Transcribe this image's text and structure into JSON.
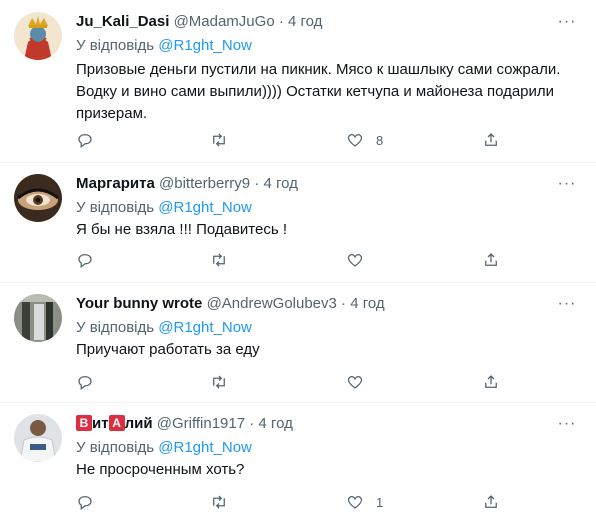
{
  "tweets": [
    {
      "name": "Ju_Kali_Dasi",
      "handle": "@MadamJuGo",
      "dot": "·",
      "time": "4 год",
      "reply_prefix": "У відповідь",
      "reply_to": "@R1ght_Now",
      "text": "Призовые деньги пустили на пикник. Мясо к шашлыку сами сожрали. Водку и вино сами выпили)))) Остатки кетчупа и майонеза подарили призерам.",
      "reply_count": "",
      "retweet_count": "",
      "like_count": "8"
    },
    {
      "name": "Маргарита",
      "handle": "@bitterberry9",
      "dot": "·",
      "time": "4 год",
      "reply_prefix": "У відповідь",
      "reply_to": "@R1ght_Now",
      "text": "Я бы не взяла !!! Подавитесь !",
      "reply_count": "",
      "retweet_count": "",
      "like_count": ""
    },
    {
      "name": "Your bunny wrote",
      "handle": "@AndrewGolubev3",
      "dot": "·",
      "time": "4 год",
      "reply_prefix": "У відповідь",
      "reply_to": "@R1ght_Now",
      "text": "Приучают работать за еду",
      "reply_count": "",
      "retweet_count": "",
      "like_count": ""
    },
    {
      "name_parts": [
        "В",
        "ит",
        "А",
        "лий"
      ],
      "handle": "@Griffin1917",
      "dot": "·",
      "time": "4 год",
      "reply_prefix": "У відповідь",
      "reply_to": "@R1ght_Now",
      "text": "Не просроченным хоть?",
      "reply_count": "",
      "retweet_count": "",
      "like_count": "1"
    }
  ],
  "icons": {
    "more": "more-icon",
    "reply": "reply-icon",
    "retweet": "retweet-icon",
    "like": "like-icon",
    "share": "share-icon"
  },
  "colors": {
    "link": "#1d9bf0",
    "muted": "#536471",
    "text": "#0f1419",
    "badge": "#dd2e44"
  }
}
